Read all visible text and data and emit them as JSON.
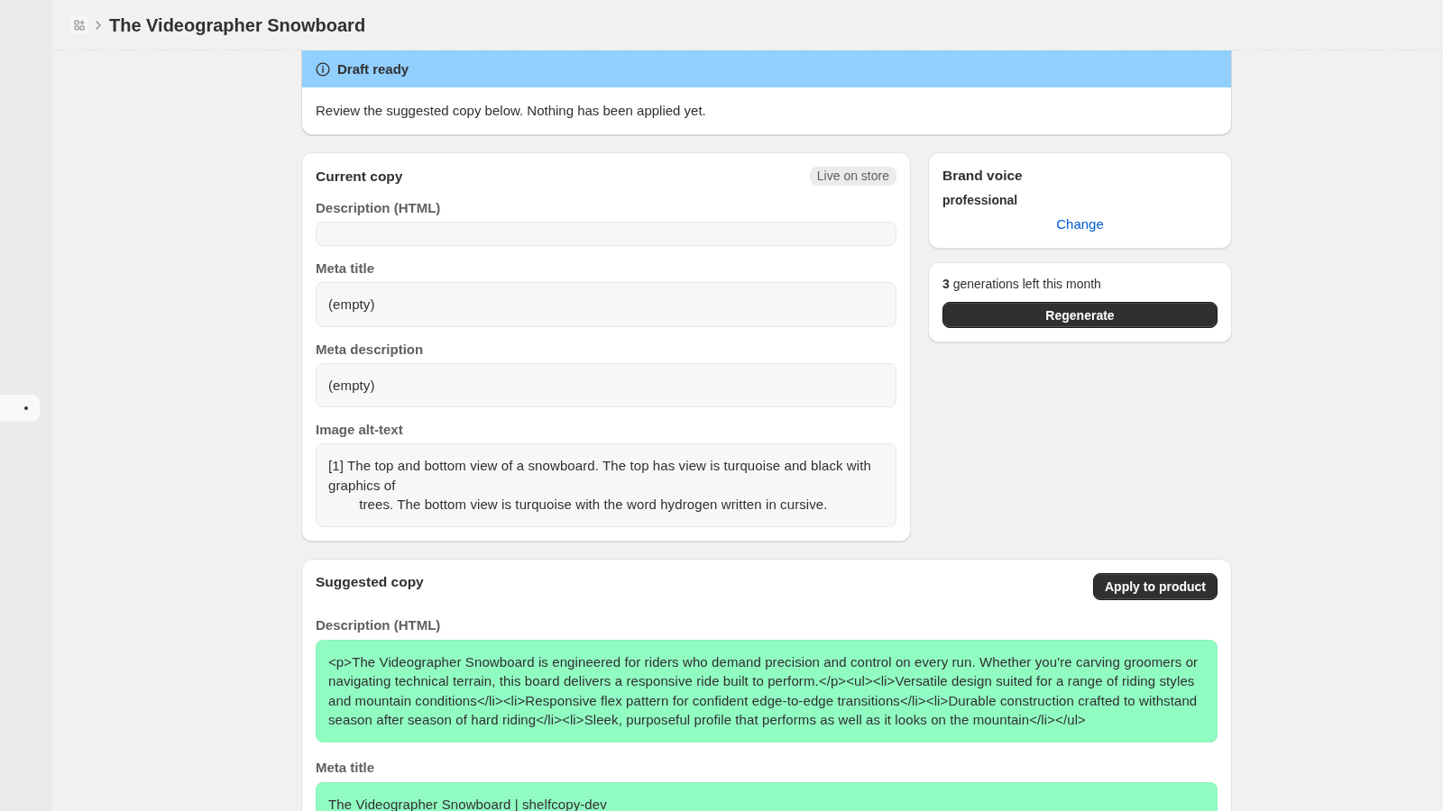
{
  "header": {
    "title": "The Videographer Snowboard"
  },
  "banner": {
    "title": "Draft ready",
    "message": "Review the suggested copy below. Nothing has been applied yet."
  },
  "current_copy": {
    "title": "Current copy",
    "badge": "Live on store",
    "fields": [
      {
        "label": "Description (HTML)"
      },
      {
        "label": "Meta title",
        "value": "(empty)"
      },
      {
        "label": "Meta description",
        "value": "(empty)"
      },
      {
        "label": "Image alt-text",
        "value": "[1] The top and bottom view of a snowboard. The top has view is turquoise and black with graphics of\n        trees. The bottom view is turquoise with the word hydrogen written in cursive."
      }
    ]
  },
  "brand_voice": {
    "title": "Brand voice",
    "value": "professional",
    "link": "Change"
  },
  "usage": {
    "text": "**3** generations left this month",
    "button": "Regenerate"
  },
  "suggested_copy": {
    "title": "Suggested copy",
    "button": "Apply to product",
    "fields": [
      {
        "label": "Description (HTML)",
        "value": "<p>The Videographer Snowboard is engineered for riders who demand precision and control on every run. Whether you're carving groomers or navigating technical terrain, this board delivers a responsive ride built to perform.</p><ul><li>Versatile design suited for a range of riding styles and mountain conditions</li><li>Responsive flex pattern for confident edge-to-edge transitions</li><li>Durable construction crafted to withstand season after season of hard riding</li><li>Sleek, purposeful profile that performs as well as it looks on the mountain</li></ul>",
        "changed": true
      },
      {
        "label": "Meta title",
        "value": "The Videographer Snowboard | shelfcopy-dev",
        "changed": true
      }
    ]
  }
}
